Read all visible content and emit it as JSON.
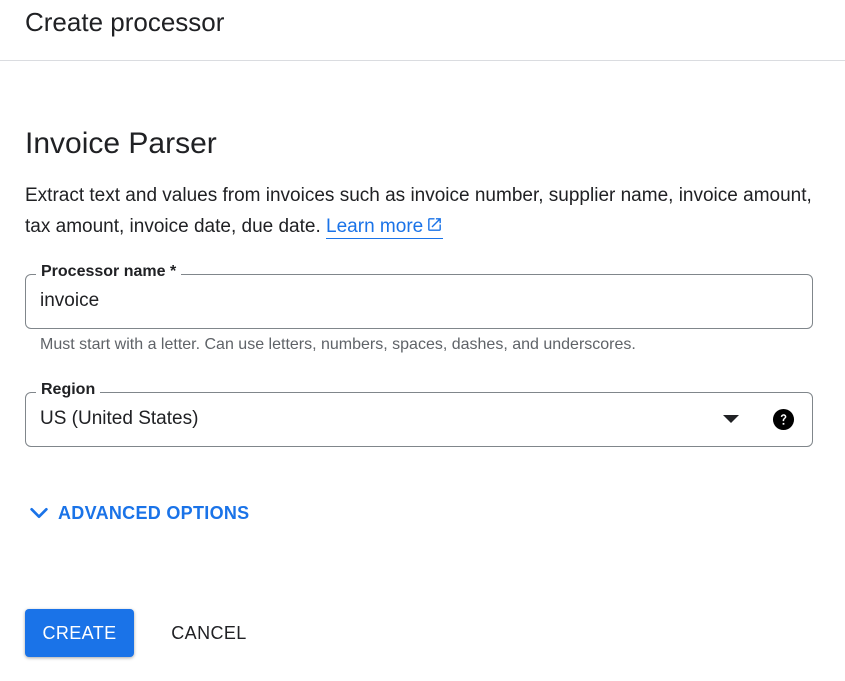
{
  "header": {
    "title": "Create processor"
  },
  "processor": {
    "title": "Invoice Parser",
    "description": "Extract text and values from invoices such as invoice number, supplier name, invoice amount, tax amount, invoice date, due date.",
    "learn_more": "Learn more",
    "learn_more_icon": "external-link-icon"
  },
  "form": {
    "name_label": "Processor name *",
    "name_value": "invoice",
    "name_hint": "Must start with a letter. Can use letters, numbers, spaces, dashes, and underscores.",
    "region_label": "Region",
    "region_value": "US (United States)",
    "region_icons": [
      "dropdown-arrow-icon",
      "help-icon"
    ]
  },
  "advanced": {
    "label": "ADVANCED OPTIONS",
    "icon": "chevron-down-icon"
  },
  "actions": {
    "create_label": "CREATE",
    "cancel_label": "CANCEL"
  },
  "colors": {
    "accent": "#1a73e8",
    "text": "#202124",
    "muted": "#5f6368",
    "border": "#80868b"
  }
}
